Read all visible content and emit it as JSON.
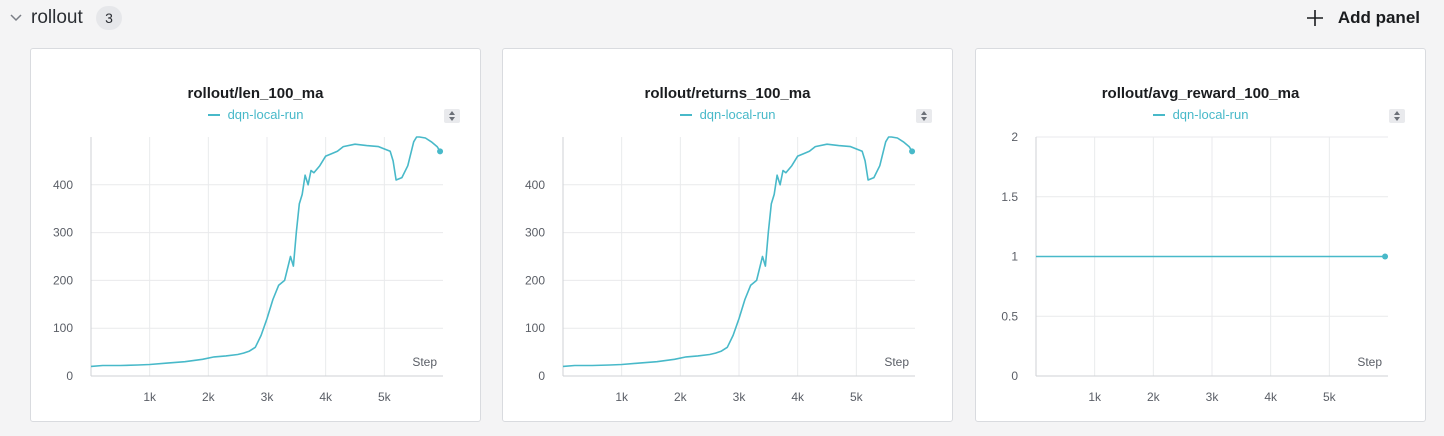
{
  "section": {
    "title": "rollout",
    "count": "3",
    "add_panel_label": "Add panel"
  },
  "colors": {
    "series": "#48b9c9",
    "grid": "#e9eaec",
    "axis": "#cfd2d6"
  },
  "chart_data": [
    {
      "type": "line",
      "title": "rollout/len_100_ma",
      "xlabel": "Step",
      "ylabel": "",
      "xlim": [
        0,
        6000
      ],
      "ylim": [
        0,
        500
      ],
      "x_ticks": [
        1000,
        2000,
        3000,
        4000,
        5000
      ],
      "x_tick_labels": [
        "1k",
        "2k",
        "3k",
        "4k",
        "5k"
      ],
      "y_ticks": [
        0,
        100,
        200,
        300,
        400
      ],
      "y_tick_labels": [
        "0",
        "100",
        "200",
        "300",
        "400"
      ],
      "grid": true,
      "legend": "top-center",
      "series": [
        {
          "name": "dqn-local-run",
          "x": [
            0,
            200,
            500,
            800,
            1000,
            1300,
            1600,
            1900,
            2100,
            2300,
            2500,
            2600,
            2700,
            2800,
            2900,
            3000,
            3100,
            3200,
            3300,
            3400,
            3450,
            3500,
            3550,
            3600,
            3650,
            3700,
            3750,
            3800,
            3900,
            4000,
            4100,
            4200,
            4300,
            4500,
            4700,
            4900,
            5100,
            5150,
            5200,
            5300,
            5400,
            5500,
            5550,
            5600,
            5700,
            5800,
            5900,
            5950
          ],
          "y": [
            20,
            22,
            22,
            23,
            24,
            27,
            30,
            35,
            40,
            42,
            45,
            48,
            52,
            60,
            85,
            120,
            160,
            190,
            200,
            250,
            230,
            300,
            360,
            380,
            420,
            400,
            430,
            425,
            440,
            460,
            465,
            470,
            480,
            485,
            482,
            480,
            470,
            450,
            410,
            415,
            440,
            490,
            500,
            500,
            498,
            490,
            480,
            470
          ]
        }
      ]
    },
    {
      "type": "line",
      "title": "rollout/returns_100_ma",
      "xlabel": "Step",
      "ylabel": "",
      "xlim": [
        0,
        6000
      ],
      "ylim": [
        0,
        500
      ],
      "x_ticks": [
        1000,
        2000,
        3000,
        4000,
        5000
      ],
      "x_tick_labels": [
        "1k",
        "2k",
        "3k",
        "4k",
        "5k"
      ],
      "y_ticks": [
        0,
        100,
        200,
        300,
        400
      ],
      "y_tick_labels": [
        "0",
        "100",
        "200",
        "300",
        "400"
      ],
      "grid": true,
      "legend": "top-center",
      "series": [
        {
          "name": "dqn-local-run",
          "x": [
            0,
            200,
            500,
            800,
            1000,
            1300,
            1600,
            1900,
            2100,
            2300,
            2500,
            2600,
            2700,
            2800,
            2900,
            3000,
            3100,
            3200,
            3300,
            3400,
            3450,
            3500,
            3550,
            3600,
            3650,
            3700,
            3750,
            3800,
            3900,
            4000,
            4100,
            4200,
            4300,
            4500,
            4700,
            4900,
            5100,
            5150,
            5200,
            5300,
            5400,
            5500,
            5550,
            5600,
            5700,
            5800,
            5900,
            5950
          ],
          "y": [
            20,
            22,
            22,
            23,
            24,
            27,
            30,
            35,
            40,
            42,
            45,
            48,
            52,
            60,
            85,
            120,
            160,
            190,
            200,
            250,
            230,
            300,
            360,
            380,
            420,
            400,
            430,
            425,
            440,
            460,
            465,
            470,
            480,
            485,
            482,
            480,
            470,
            450,
            410,
            415,
            440,
            490,
            500,
            500,
            498,
            490,
            480,
            470
          ]
        }
      ]
    },
    {
      "type": "line",
      "title": "rollout/avg_reward_100_ma",
      "xlabel": "Step",
      "ylabel": "",
      "xlim": [
        0,
        6000
      ],
      "ylim": [
        0,
        2
      ],
      "x_ticks": [
        1000,
        2000,
        3000,
        4000,
        5000
      ],
      "x_tick_labels": [
        "1k",
        "2k",
        "3k",
        "4k",
        "5k"
      ],
      "y_ticks": [
        0,
        0.5,
        1,
        1.5,
        2
      ],
      "y_tick_labels": [
        "0",
        "0.5",
        "1",
        "1.5",
        "2"
      ],
      "grid": true,
      "legend": "top-center",
      "series": [
        {
          "name": "dqn-local-run",
          "x": [
            0,
            1000,
            2000,
            3000,
            4000,
            5000,
            5950
          ],
          "y": [
            1,
            1,
            1,
            1,
            1,
            1,
            1
          ]
        }
      ]
    }
  ]
}
